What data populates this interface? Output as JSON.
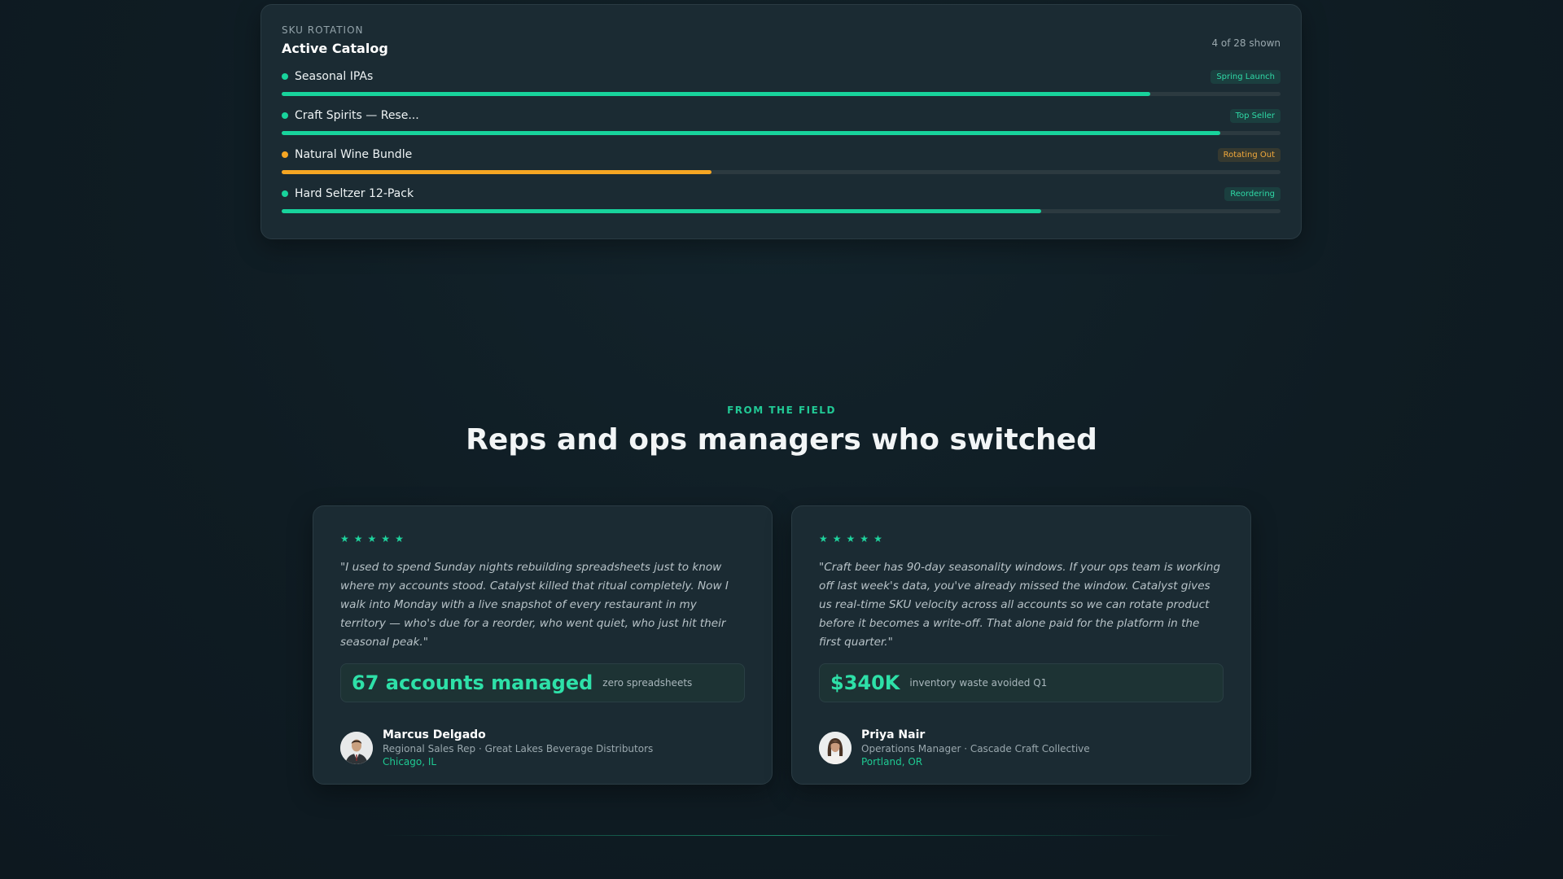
{
  "sku": {
    "kicker": "SKU ROTATION",
    "title": "Active Catalog",
    "shown": "4 of 28 shown",
    "items": [
      {
        "name": "Seasonal IPAs",
        "badge": "Spring Launch",
        "progress": 0.87,
        "status": "ok"
      },
      {
        "name": "Craft Spirits — Rese...",
        "badge": "Top Seller",
        "progress": 0.94,
        "status": "ok"
      },
      {
        "name": "Natural Wine Bundle",
        "badge": "Rotating Out",
        "progress": 0.43,
        "status": "warn"
      },
      {
        "name": "Hard Seltzer 12-Pack",
        "badge": "Reordering",
        "progress": 0.76,
        "status": "ok"
      }
    ]
  },
  "colors": {
    "accent": "#18d39c",
    "warning": "#f5a623",
    "background": "#0f1c23",
    "card": "#1b2b33"
  },
  "section": {
    "eyebrow": "FROM THE FIELD",
    "title": "Reps and ops managers who switched"
  },
  "testimonials": [
    {
      "rating": 5,
      "quote": "\"I used to spend Sunday nights rebuilding spreadsheets just to know where my accounts stood. Catalyst killed that ritual completely. Now I walk into Monday with a live snapshot of every restaurant in my territory — who's due for a reorder, who went quiet, who just hit their seasonal peak.\"",
      "stat_value": "67 accounts managed",
      "stat_note": "zero spreadsheets",
      "name": "Marcus Delgado",
      "role": "Regional Sales Rep · Great Lakes Beverage Distributors",
      "location": "Chicago, IL"
    },
    {
      "rating": 5,
      "quote": "\"Craft beer has 90-day seasonality windows. If your ops team is working off last week's data, you've already missed the window. Catalyst gives us real-time SKU velocity across all accounts so we can rotate product before it becomes a write-off. That alone paid for the platform in the first quarter.\"",
      "stat_value": "$340K",
      "stat_note": "inventory waste avoided Q1",
      "name": "Priya Nair",
      "role": "Operations Manager · Cascade Craft Collective",
      "location": "Portland, OR"
    }
  ]
}
